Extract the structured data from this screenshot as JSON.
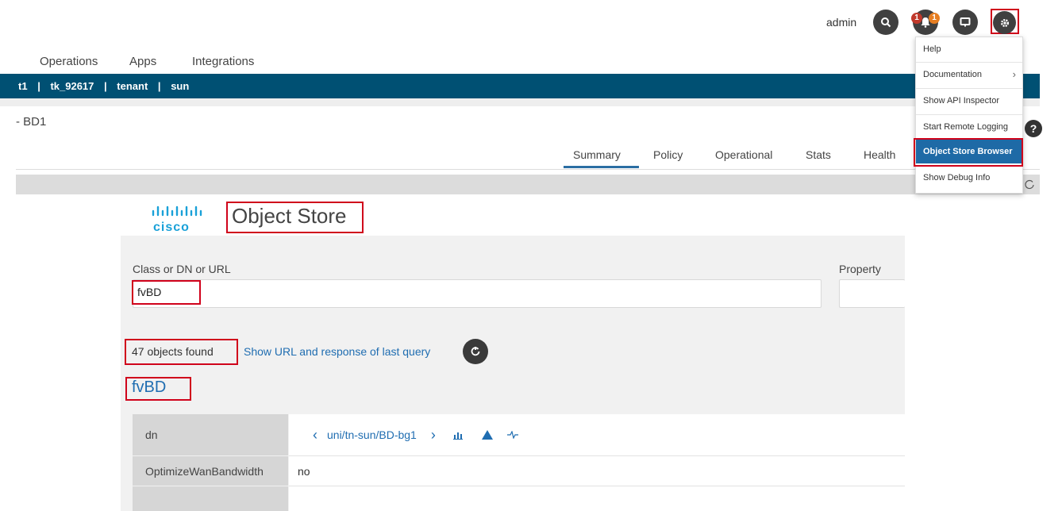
{
  "header": {
    "user": "admin",
    "notification_badges": [
      "1",
      "1"
    ]
  },
  "topnav": [
    "Operations",
    "Apps",
    "Integrations"
  ],
  "breadcrumb": [
    "t1",
    "tk_92617",
    "tenant",
    "sun"
  ],
  "page_title": "- BD1",
  "tabs": [
    "Summary",
    "Policy",
    "Operational",
    "Stats",
    "Health"
  ],
  "dropdown": {
    "items": [
      "Help",
      "Documentation",
      "Show API Inspector",
      "Start Remote Logging",
      "Object Store Browser",
      "Show Debug Info"
    ],
    "active": "Object Store Browser"
  },
  "object_store": {
    "logo_text": "cisco",
    "title": "Object Store",
    "class_label": "Class or DN or URL",
    "class_value": "fvBD",
    "property_label": "Property",
    "count_text": "47 objects found",
    "show_url_link": "Show URL and response of last query",
    "class_heading": "fvBD",
    "rows": [
      {
        "label": "dn",
        "value": "uni/tn-sun/BD-bg1"
      },
      {
        "label": "OptimizeWanBandwidth",
        "value": "no"
      }
    ]
  },
  "colors": {
    "brand_blue": "#005073",
    "link_blue": "#1f6db1",
    "highlight_red": "#d0021b",
    "active_menu": "#1e6aa6"
  }
}
